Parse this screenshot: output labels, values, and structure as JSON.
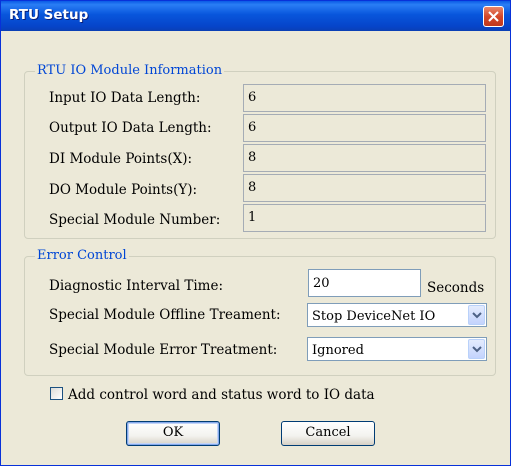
{
  "window": {
    "title": "RTU Setup",
    "title_bar_color": "#0a5ae6",
    "close_icon": "close-icon"
  },
  "io_group": {
    "legend": "RTU IO Module Information",
    "rows": [
      {
        "label": "Input IO Data Length:",
        "value": "6"
      },
      {
        "label": "Output IO Data Length:",
        "value": "6"
      },
      {
        "label": "DI Module Points(X):",
        "value": "8"
      },
      {
        "label": "DO Module Points(Y):",
        "value": "8"
      },
      {
        "label": "Special Module Number:",
        "value": "1"
      }
    ]
  },
  "error_group": {
    "legend": "Error Control",
    "diagnostic": {
      "label": "Diagnostic Interval Time:",
      "value": "20",
      "unit": "Seconds"
    },
    "offline": {
      "label": "Special Module Offline Treament:",
      "selected": "Stop DeviceNet IO"
    },
    "error_treatment": {
      "label": "Special Module Error Treatment:",
      "selected": "Ignored"
    }
  },
  "checkbox": {
    "label": "Add control word and status word to IO data",
    "checked": false
  },
  "buttons": {
    "ok": "OK",
    "cancel": "Cancel"
  },
  "colors": {
    "legend_text": "#0046d5",
    "dialog_bg": "#ece9d8"
  }
}
